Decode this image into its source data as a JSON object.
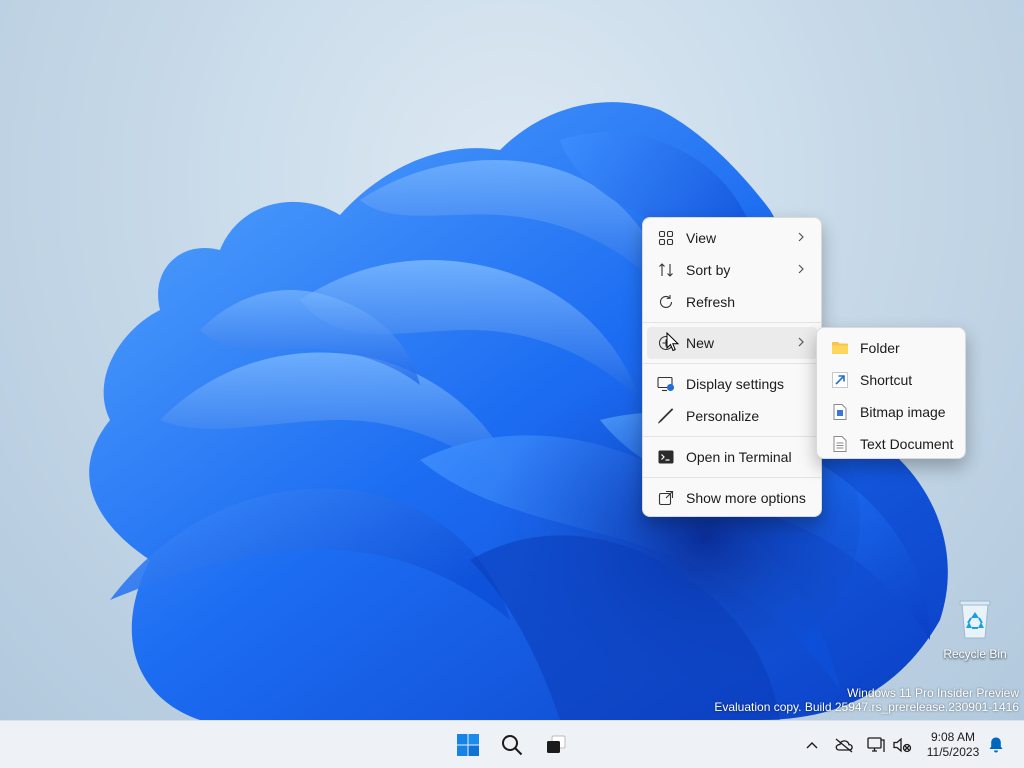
{
  "context_menu": {
    "items": [
      {
        "label": "View"
      },
      {
        "label": "Sort by"
      },
      {
        "label": "Refresh"
      },
      {
        "label": "New"
      },
      {
        "label": "Display settings"
      },
      {
        "label": "Personalize"
      },
      {
        "label": "Open in Terminal"
      },
      {
        "label": "Show more options"
      }
    ]
  },
  "new_submenu": {
    "items": [
      {
        "label": "Folder"
      },
      {
        "label": "Shortcut"
      },
      {
        "label": "Bitmap image"
      },
      {
        "label": "Text Document"
      }
    ]
  },
  "desktop": {
    "icons": [
      {
        "label": "Recycle Bin",
        "icon": "recycle-bin-icon"
      }
    ],
    "watermark": {
      "line1": "Windows 11 Pro Insider Preview",
      "line2": "Evaluation copy. Build 25947.rs_prerelease.230901-1416"
    }
  },
  "taskbar": {
    "apps": [
      "start-icon",
      "search-icon",
      "task-view-icon"
    ],
    "tray": [
      "show-hidden-icons",
      "onedrive-icon",
      "network-icon",
      "volume-icon",
      "notifications-icon"
    ],
    "clock": {
      "time": "9:08 AM",
      "date": "11/5/2023"
    }
  },
  "colors": {
    "accent": "#0067c0",
    "wallpaper_bloom": "#1a6cf0",
    "menu_background": "#f9f9f9",
    "taskbar_background": "#eef1f5"
  }
}
